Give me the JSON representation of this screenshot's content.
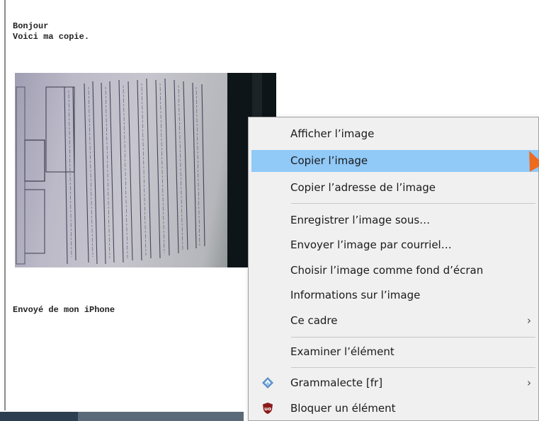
{
  "email": {
    "greeting": "Bonjour",
    "line2": "Voici ma copie.",
    "signature": "Envoyé de mon iPhone"
  },
  "context_menu": {
    "items": [
      {
        "label": "Afficher l’image"
      },
      {
        "label": "Copier l’image",
        "highlighted": true
      },
      {
        "label": "Copier l’adresse de l’image"
      },
      {
        "label": "Enregistrer l’image sous…"
      },
      {
        "label": "Envoyer l’image par courriel…"
      },
      {
        "label": "Choisir l’image comme fond d’écran"
      },
      {
        "label": "Informations sur l’image"
      },
      {
        "label": "Ce cadre",
        "submenu": true
      },
      {
        "label": "Examiner l’élément"
      },
      {
        "label": "Grammalecte [fr]",
        "submenu": true,
        "icon": "grammalecte-icon"
      },
      {
        "label": "Bloquer un élément",
        "icon": "ublock-origin-icon"
      }
    ],
    "submenu_glyph": "›"
  },
  "colors": {
    "menu_highlight": "#91c9f7",
    "menu_background": "#f0f0f0",
    "cursor": "#ee6a1e"
  }
}
